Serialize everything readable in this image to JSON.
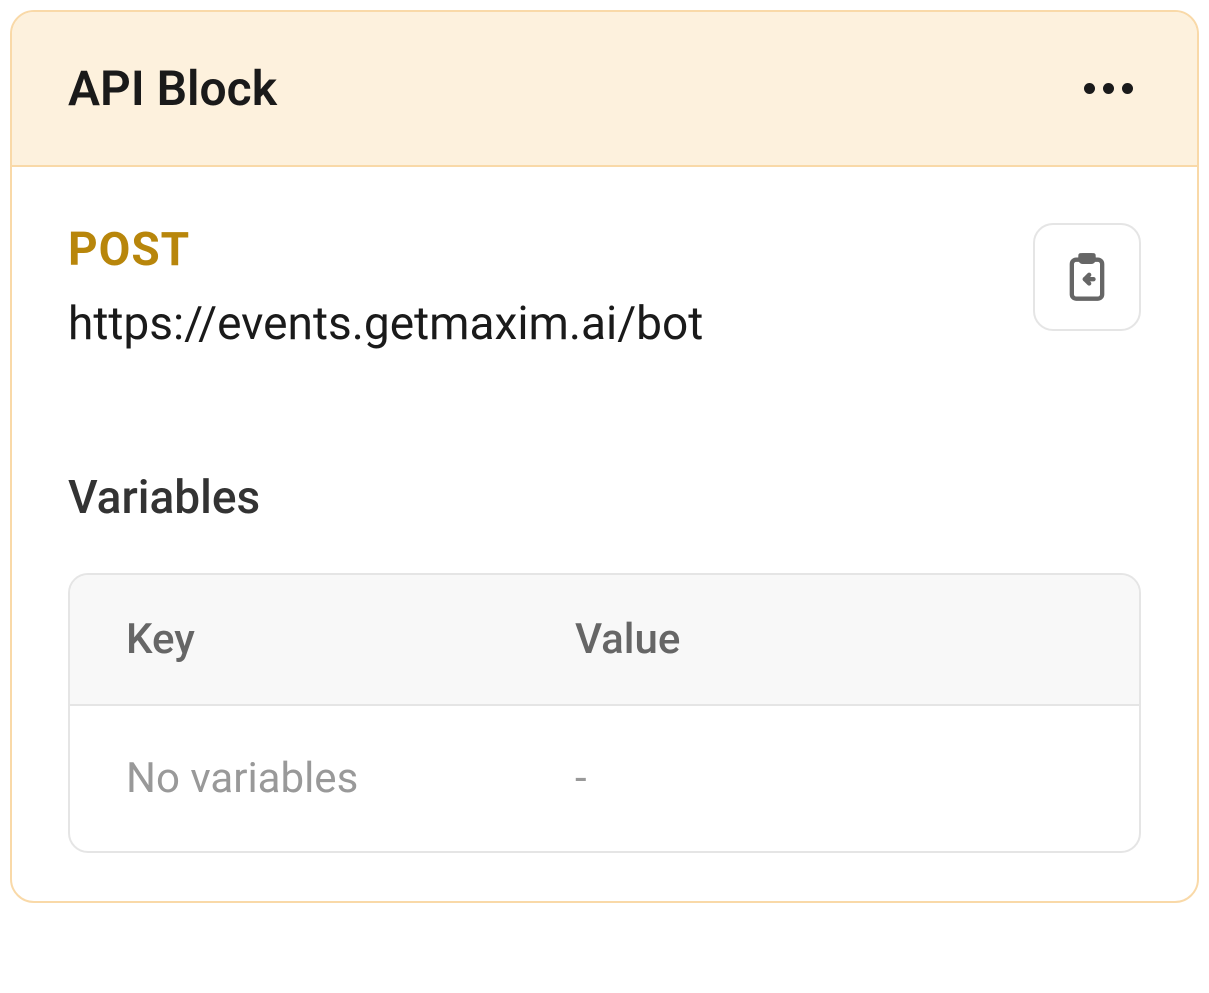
{
  "header": {
    "title": "API Block"
  },
  "request": {
    "method": "POST",
    "url": "https://events.getmaxim.ai/bot"
  },
  "variables": {
    "section_title": "Variables",
    "columns": {
      "key": "Key",
      "value": "Value"
    },
    "empty_state": {
      "key": "No variables",
      "value": "-"
    }
  }
}
